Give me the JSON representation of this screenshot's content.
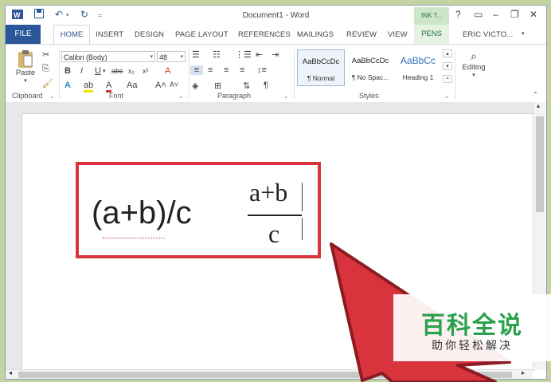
{
  "window": {
    "title": "Document1 - Word",
    "ink_tools_label": "INK T..."
  },
  "qat": {
    "word_icon": "word-logo-icon",
    "save_icon": "save-icon",
    "undo_icon": "undo-icon",
    "redo_icon": "redo-icon"
  },
  "title_controls": {
    "help": "?",
    "ribbon_display": "▭",
    "minimize": "–",
    "restore": "❐",
    "close": "✕"
  },
  "tabs": {
    "file": "FILE",
    "items": [
      "HOME",
      "INSERT",
      "DESIGN",
      "PAGE LAYOUT",
      "REFERENCES",
      "MAILINGS",
      "REVIEW",
      "VIEW",
      "PENS"
    ],
    "user": "ERIC VICTO...",
    "active": "HOME"
  },
  "ribbon": {
    "clipboard": {
      "paste_label": "Paste",
      "group_label": "Clipboard"
    },
    "font": {
      "font_name": "Calibri (Body)",
      "font_size": "48",
      "group_label": "Font",
      "bold": "B",
      "italic": "I",
      "underline": "U",
      "strike": "abc",
      "subscript": "x₂",
      "superscript": "x²",
      "grow": "A˄",
      "shrink": "A˅",
      "case": "Aa",
      "clear": "A"
    },
    "paragraph": {
      "group_label": "Paragraph",
      "pilcrow": "¶"
    },
    "styles": {
      "group_label": "Styles",
      "items": [
        {
          "sample": "AaBbCcDc",
          "name": "¶ Normal"
        },
        {
          "sample": "AaBbCcDc",
          "name": "¶ No Spac..."
        },
        {
          "sample": "AaBbCc",
          "name": "Heading 1"
        }
      ]
    },
    "editing": {
      "label": "Editing"
    }
  },
  "document": {
    "equation_linear": "(a+b)/c",
    "fraction_numerator": "a+b",
    "fraction_denominator": "c"
  },
  "watermark": {
    "main": "百科全说",
    "sub": "助你轻松解决"
  },
  "colors": {
    "accent": "#2b579a",
    "highlight_box": "#d9343e",
    "arrow": "#d9343e",
    "watermark_green": "#2aa14a"
  }
}
